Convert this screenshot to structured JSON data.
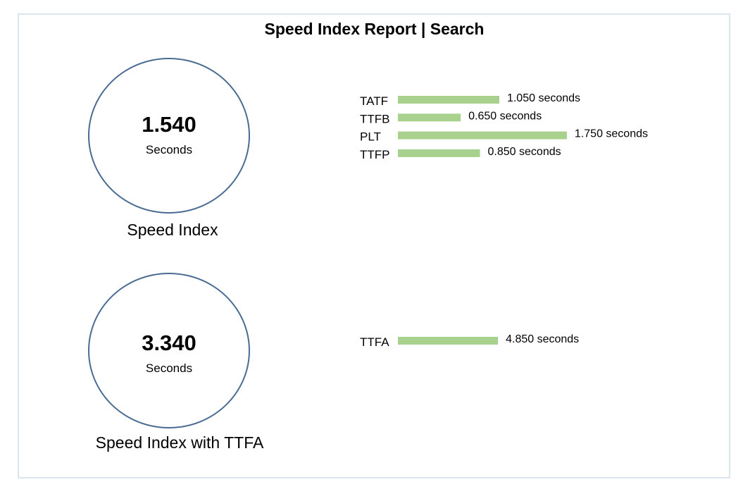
{
  "title": "Speed Index Report | Search",
  "colors": {
    "bar": "#a9d18e",
    "circle_border": "#4a6b92",
    "frame_border": "#d9e6ee"
  },
  "metrics": [
    {
      "value": "1.540",
      "unit": "Seconds",
      "caption": "Speed Index"
    },
    {
      "value": "3.340",
      "unit": "Seconds",
      "caption": "Speed Index with TTFA"
    }
  ],
  "chart_data": [
    {
      "type": "bar",
      "orientation": "horizontal",
      "categories": [
        "TATF",
        "TTFB",
        "PLT",
        "TTFP"
      ],
      "values": [
        1.05,
        0.65,
        1.75,
        0.85
      ],
      "data_labels": [
        "1.050 seconds",
        "0.650 seconds",
        "1.750 seconds",
        "0.850 seconds"
      ],
      "unit": "seconds",
      "bar_color": "#a9d18e",
      "grid": false,
      "legend": "none"
    },
    {
      "type": "bar",
      "orientation": "horizontal",
      "categories": [
        "TTFA"
      ],
      "values": [
        4.85
      ],
      "data_labels": [
        "4.850 seconds"
      ],
      "unit": "seconds",
      "bar_color": "#a9d18e",
      "grid": false,
      "legend": "none"
    }
  ]
}
